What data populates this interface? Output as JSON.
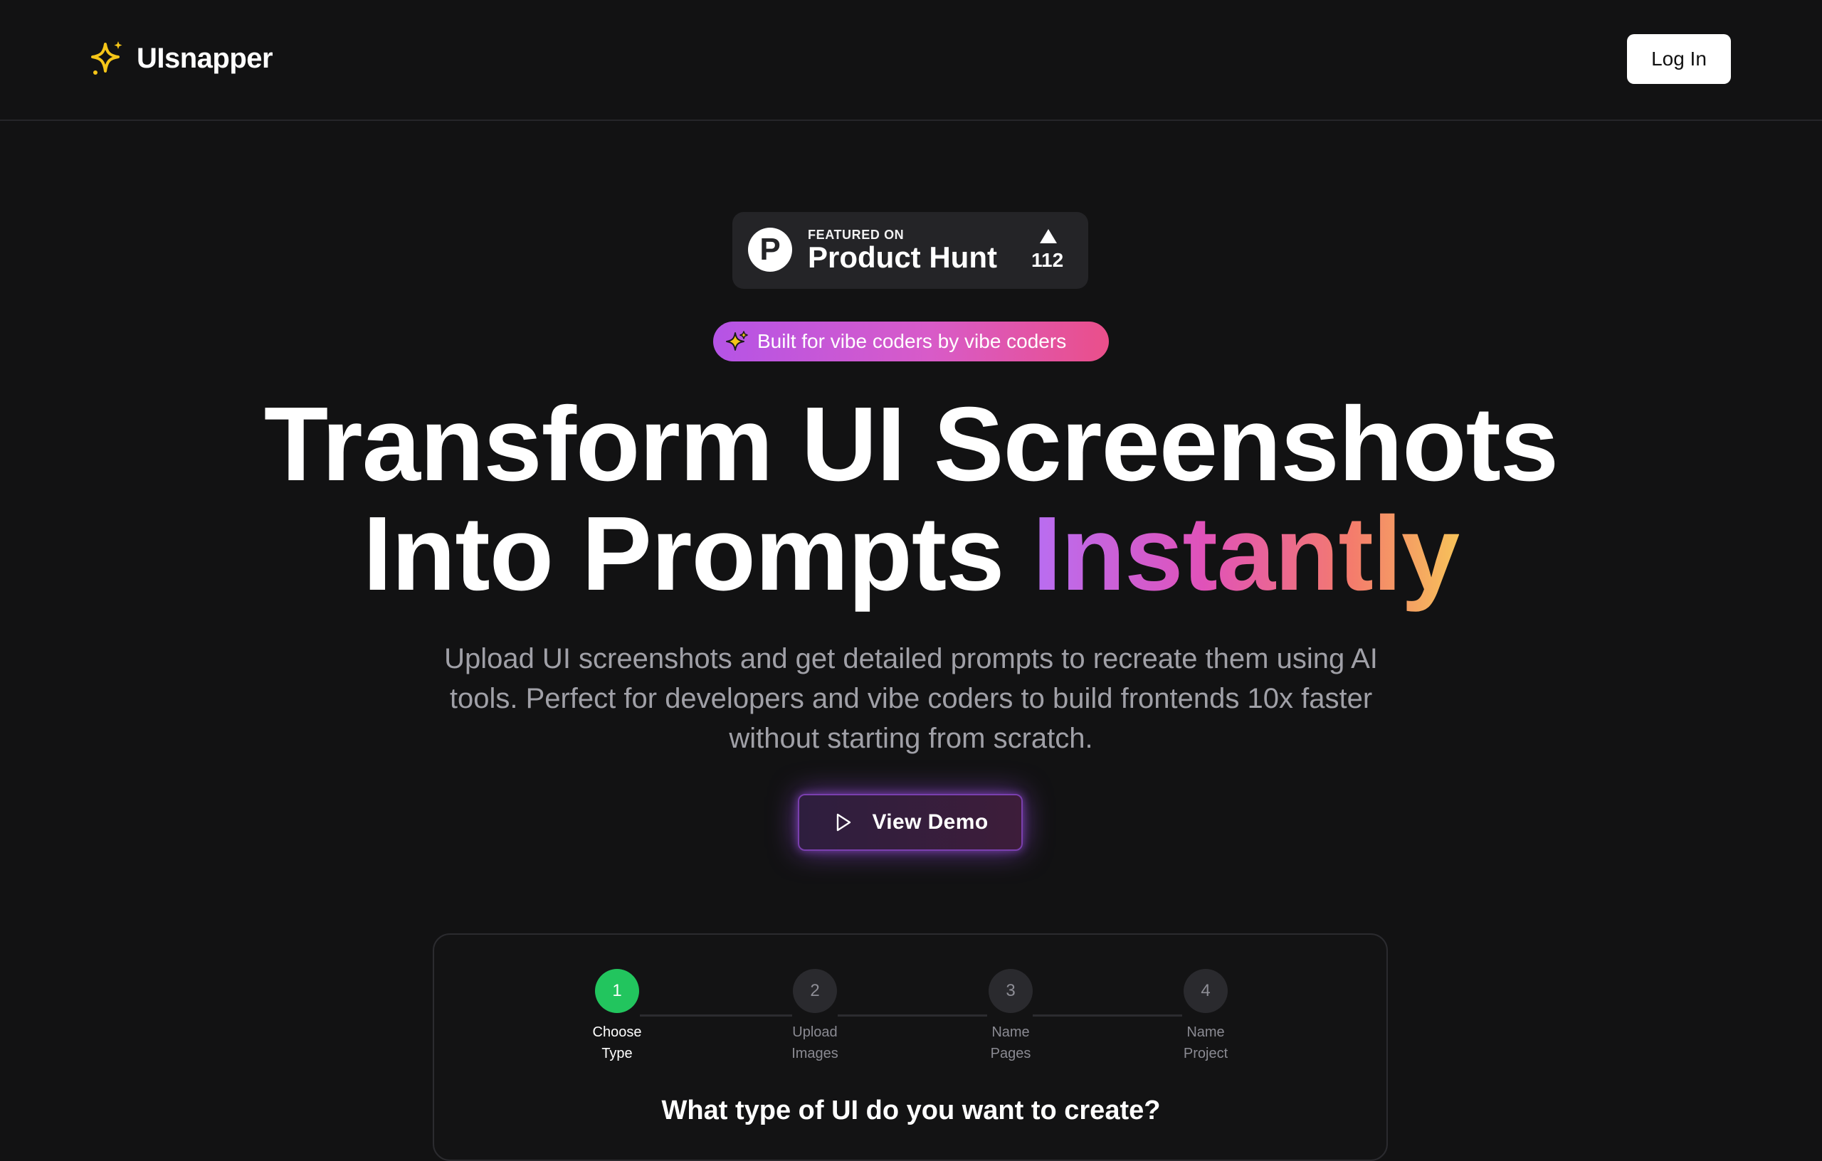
{
  "header": {
    "brand": "UIsnapper",
    "login_label": "Log In"
  },
  "product_hunt": {
    "featured_on": "FEATURED ON",
    "title": "Product Hunt",
    "votes": "112",
    "icon_letter": "P"
  },
  "pill": {
    "label": "Built for vibe coders by vibe coders"
  },
  "hero": {
    "line1": "Transform UI Screenshots",
    "line2_plain": "Into Prompts",
    "line2_gradient": "Instantly"
  },
  "subtitle": "Upload UI screenshots and get detailed prompts to recreate them using AI tools. Perfect for developers and vibe coders to build frontends 10x faster without starting from scratch.",
  "demo_button": {
    "label": "View Demo"
  },
  "wizard": {
    "steps": [
      {
        "number": "1",
        "line1": "Choose",
        "line2": "Type"
      },
      {
        "number": "2",
        "line1": "Upload",
        "line2": "Images"
      },
      {
        "number": "3",
        "line1": "Name",
        "line2": "Pages"
      },
      {
        "number": "4",
        "line1": "Name",
        "line2": "Project"
      }
    ],
    "active_step": 1,
    "question": "What type of UI do you want to create?"
  },
  "colors": {
    "background": "#121213",
    "accent_green": "#22c55e",
    "logo_yellow": "#f5c518",
    "demo_glow": "#a855f7"
  }
}
